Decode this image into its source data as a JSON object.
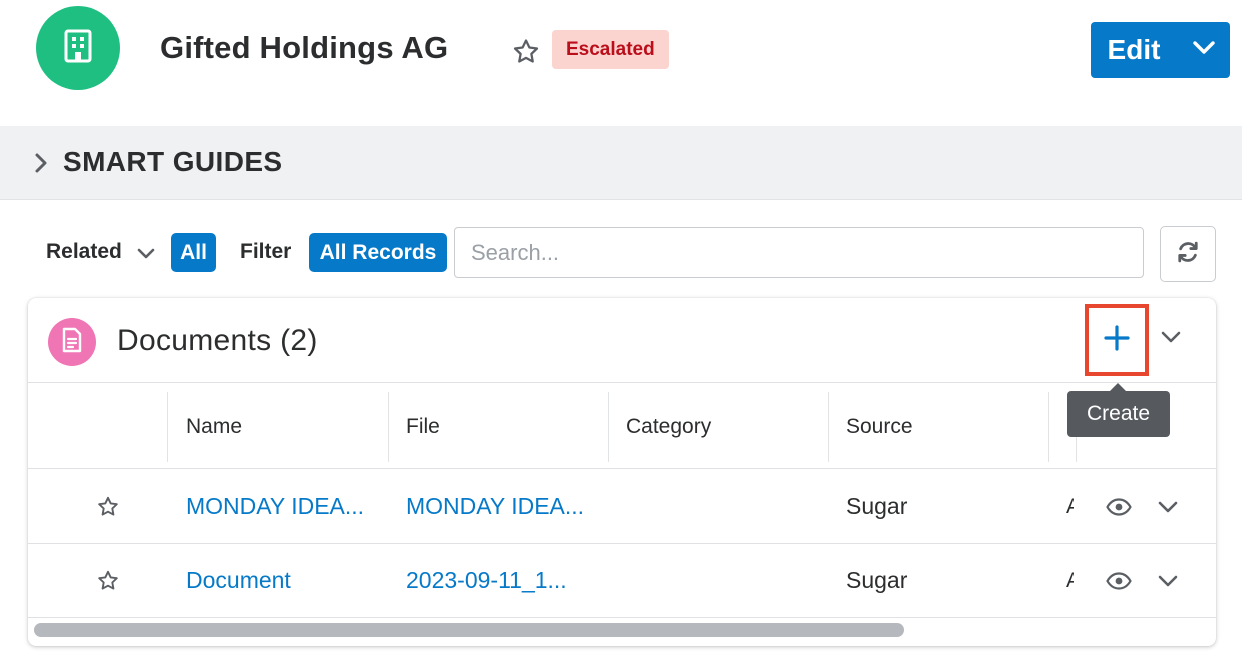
{
  "header": {
    "record_name": "Gifted Holdings AG",
    "avatar_icon": "building-icon",
    "status_badge": "Escalated",
    "edit_label": "Edit",
    "colors": {
      "avatar": "#1fbf82",
      "badge_bg": "#fbd3cf",
      "badge_text": "#bb0e1b",
      "primary": "#0679c8"
    }
  },
  "smart_guides": {
    "label": "SMART GUIDES",
    "expanded": false
  },
  "filterbar": {
    "related_label": "Related",
    "related_value": "All",
    "filter_label": "Filter",
    "filter_value": "All Records",
    "search_placeholder": "Search...",
    "search_value": ""
  },
  "dashlet": {
    "title": "Documents (2)",
    "icon": "document-icon",
    "create_tooltip": "Create",
    "columns": [
      "Name",
      "File",
      "Category",
      "Source"
    ],
    "rows": [
      {
        "name": "MONDAY IDEA...",
        "file": "MONDAY IDEA...",
        "category": "",
        "source": "Sugar",
        "truncated": "A"
      },
      {
        "name": "Document",
        "file": "2023-09-11_1...",
        "category": "",
        "source": "Sugar",
        "truncated": "A"
      }
    ],
    "colors": {
      "icon_bg": "#f075b5",
      "highlight_border": "#e8472f"
    }
  }
}
